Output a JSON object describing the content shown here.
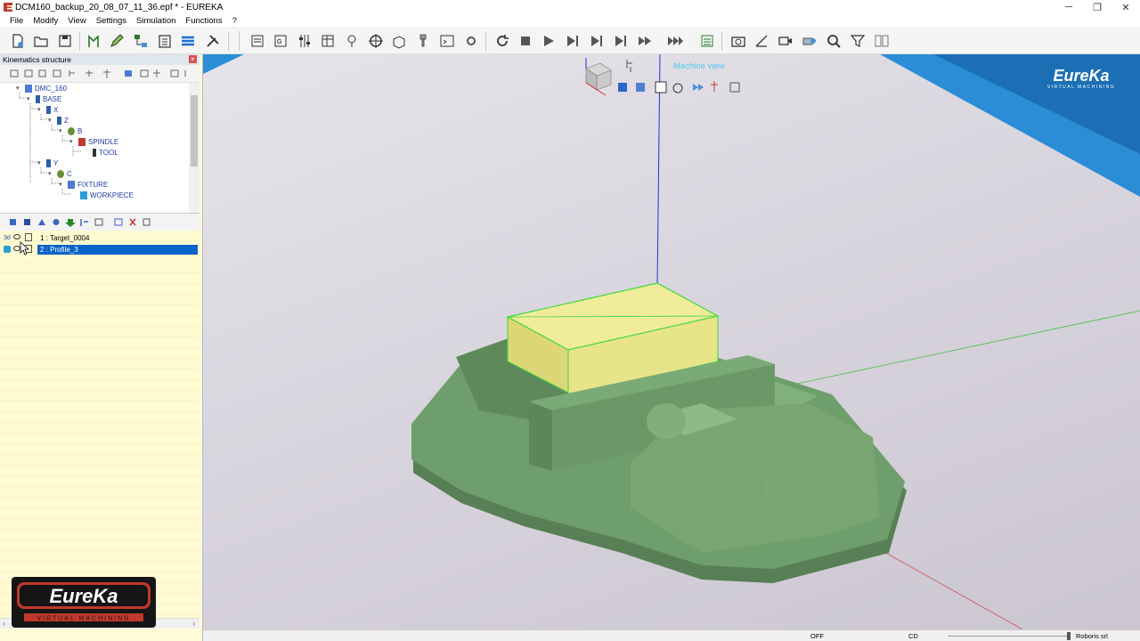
{
  "window": {
    "title": "DCM160_backup_20_08_07_11_36.epf * - EUREKA",
    "buttons": {
      "minimize": "─",
      "maximize": "❐",
      "close": "✕"
    }
  },
  "menu": [
    "File",
    "Modify",
    "View",
    "Settings",
    "Simulation",
    "Functions",
    "?"
  ],
  "kinematics": {
    "header": "Kinematics structure",
    "tree": [
      {
        "label": "DMC_160"
      },
      {
        "label": "BASE"
      },
      {
        "label": "X"
      },
      {
        "label": "Z"
      },
      {
        "label": "B"
      },
      {
        "label": "SPINDLE"
      },
      {
        "label": "TOOL"
      },
      {
        "label": "Y"
      },
      {
        "label": "C"
      },
      {
        "label": "FIXTURE"
      },
      {
        "label": "WORKPIECE"
      }
    ]
  },
  "operations": [
    {
      "label": "1 : Target_0004",
      "prefix": "3d"
    },
    {
      "label": "2 : Profile_3",
      "selected": true
    }
  ],
  "viewport": {
    "view_label": "Machine view",
    "logo": {
      "text": "EureKa",
      "subtitle": "VIRTUAL MACHINING"
    }
  },
  "badge": {
    "text": "EureKa",
    "subtitle": "VIRTUAL MACHINING"
  },
  "status": {
    "off": "OFF",
    "cd": "CD",
    "vendor": "Roboris srl"
  },
  "colors": {
    "accent": "#0a63c9",
    "panel_bg": "#fffbd8",
    "part_green": "#6e9e6b",
    "workpiece_yellow": "#e8e48a"
  }
}
